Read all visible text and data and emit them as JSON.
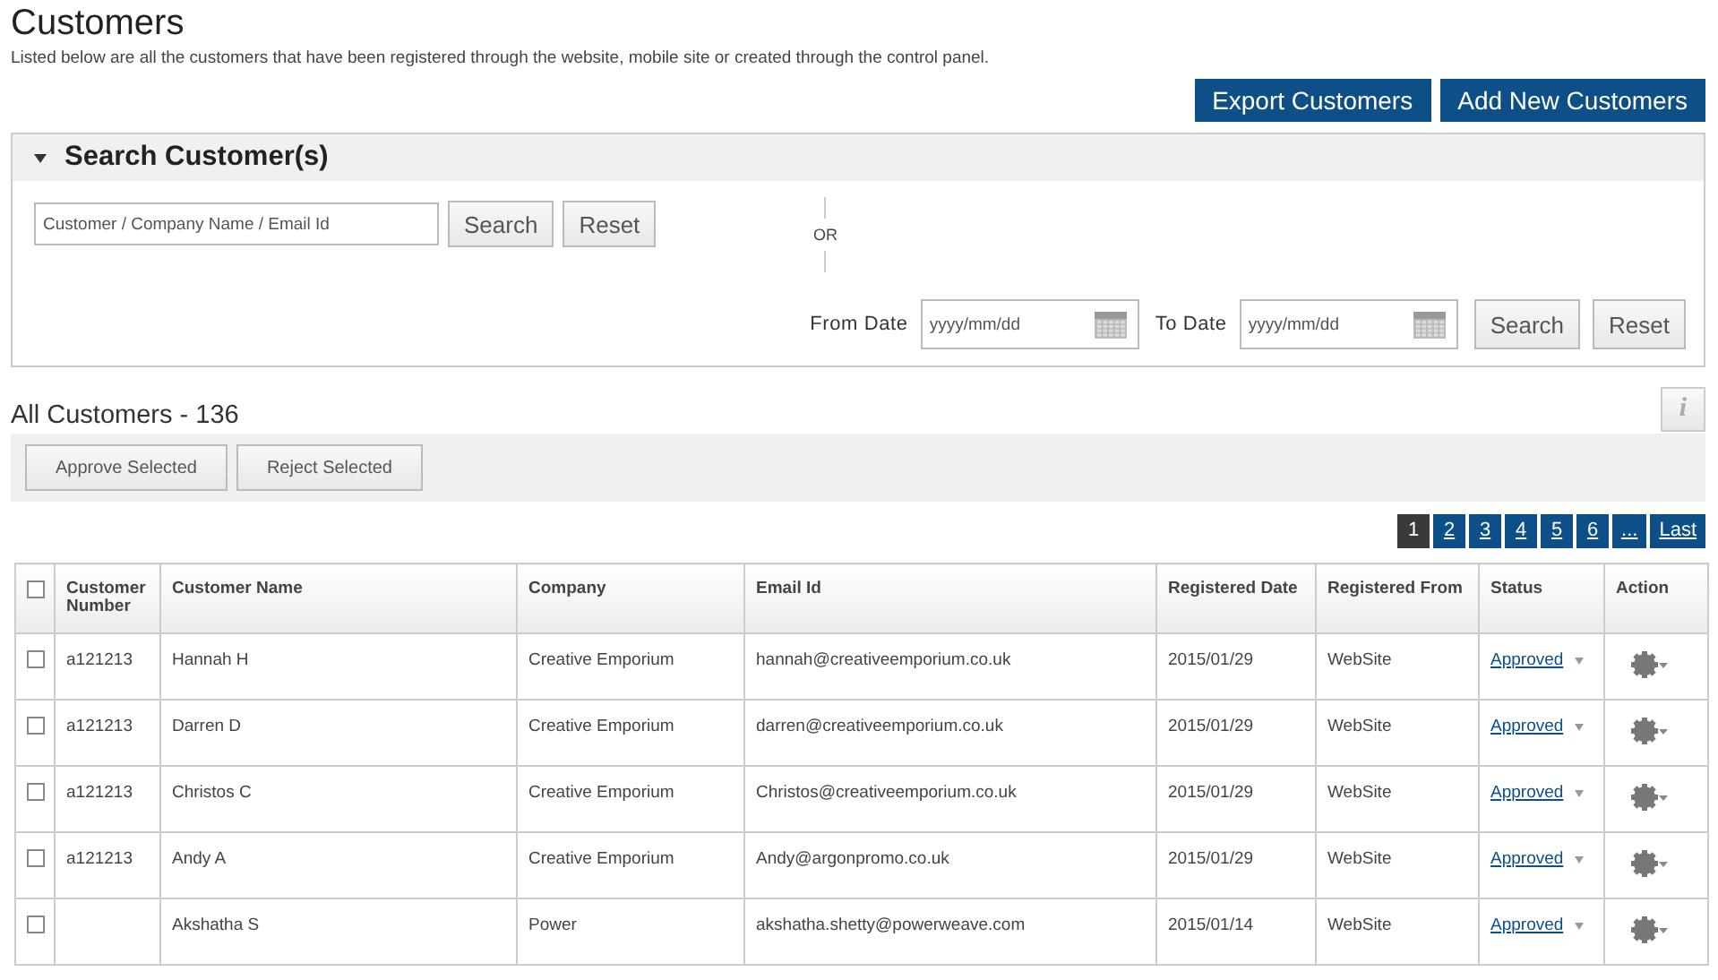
{
  "page": {
    "title": "Customers",
    "description": "Listed below are all the customers that have been registered through the website, mobile site or created through the control panel."
  },
  "header_buttons": [
    "Export Customers",
    "Add New Customers"
  ],
  "search_panel": {
    "title": "Search Customer(s)",
    "expanded": true,
    "keyword_placeholder": "Customer / Company Name / Email Id",
    "search_button": "Search",
    "reset_button": "Reset",
    "separator": "OR",
    "from_label": "From Date",
    "from_placeholder": "yyyy/mm/dd",
    "to_label": "To Date",
    "to_placeholder": "yyyy/mm/dd",
    "date_search_button": "Search",
    "date_reset_button": "Reset"
  },
  "list_title": "All Customers - 136",
  "info_button": "i",
  "bulk_actions": [
    "Approve Selected",
    "Reject Selected"
  ],
  "pagination": [
    {
      "label": "1",
      "selected": true
    },
    {
      "label": "2",
      "selected": false
    },
    {
      "label": "3",
      "selected": false
    },
    {
      "label": "4",
      "selected": false
    },
    {
      "label": "5",
      "selected": false
    },
    {
      "label": "6",
      "selected": false
    },
    {
      "label": "...",
      "selected": false
    },
    {
      "label": "Last",
      "selected": false
    }
  ],
  "table": {
    "select_all_checked": false,
    "columns": [
      "Customer Number",
      "Customer Name",
      "Company",
      "Email Id",
      "Registered Date",
      "Registered From",
      "Status",
      "Action"
    ],
    "rows": [
      {
        "checked": false,
        "number": "a121213",
        "name": "Hannah H",
        "company": "Creative Emporium",
        "email": "hannah@creativeemporium.co.uk",
        "date": "2015/01/29",
        "from": "WebSite",
        "status": "Approved"
      },
      {
        "checked": false,
        "number": "a121213",
        "name": "Darren D",
        "company": "Creative Emporium",
        "email": "darren@creativeemporium.co.uk",
        "date": "2015/01/29",
        "from": "WebSite",
        "status": "Approved"
      },
      {
        "checked": false,
        "number": "a121213",
        "name": "Christos C",
        "company": "Creative Emporium",
        "email": "Christos@creativeemporium.co.uk",
        "date": "2015/01/29",
        "from": "WebSite",
        "status": "Approved"
      },
      {
        "checked": false,
        "number": "a121213",
        "name": "Andy A",
        "company": "Creative Emporium",
        "email": "Andy@argonpromo.co.uk",
        "date": "2015/01/29",
        "from": "WebSite",
        "status": "Approved"
      },
      {
        "checked": false,
        "name": "Akshatha S",
        "company": "Power",
        "email": "akshatha.shetty@powerweave.com",
        "date": "2015/01/14",
        "from": "WebSite",
        "status": "Approved"
      }
    ]
  }
}
